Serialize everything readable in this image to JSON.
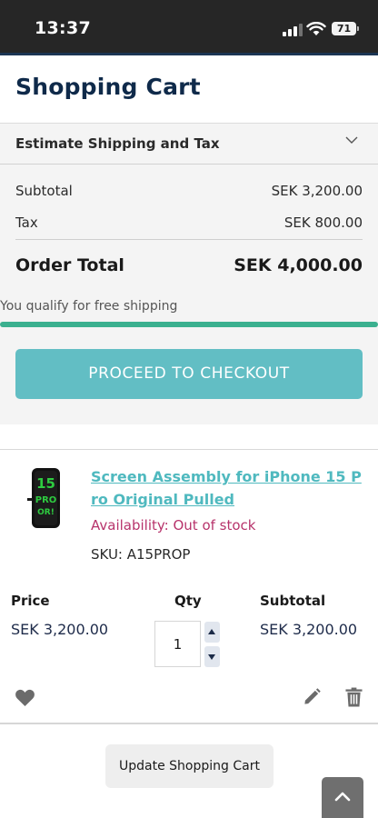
{
  "status_bar": {
    "time": "13:37",
    "battery": "71"
  },
  "page": {
    "title": "Shopping Cart"
  },
  "summary": {
    "estimate_label": "Estimate Shipping and Tax",
    "subtotal_label": "Subtotal",
    "subtotal_value": "SEK 3,200.00",
    "tax_label": "Tax",
    "tax_value": "SEK 800.00",
    "order_total_label": "Order Total",
    "order_total_value": "SEK 4,000.00",
    "free_shipping_text": "You qualify for free shipping",
    "free_shipping_progress_pct": 100,
    "checkout_label": "PROCEED TO CHECKOUT"
  },
  "cart_item": {
    "name": "Screen Assembly for iPhone 15 Pro Original Pulled",
    "image_label": "15 PRO OR!",
    "availability": "Availability: Out of stock",
    "sku": "SKU: A15PROP",
    "price_header": "Price",
    "qty_header": "Qty",
    "subtotal_header": "Subtotal",
    "price": "SEK 3,200.00",
    "qty": "1",
    "subtotal": "SEK 3,200.00"
  },
  "actions": {
    "update_cart_label": "Update Shopping Cart"
  },
  "colors": {
    "brand_navy": "#0f2a4a",
    "checkout_teal": "#62bec4",
    "link_teal": "#4fb9bf",
    "out_of_stock": "#b7336b",
    "progress_green": "#3bb08f"
  },
  "icons": {
    "estimate_toggle": "chevron-down-icon",
    "wishlist": "heart-icon",
    "edit": "pencil-icon",
    "remove": "trash-icon",
    "scroll_top": "chevron-up-icon"
  }
}
